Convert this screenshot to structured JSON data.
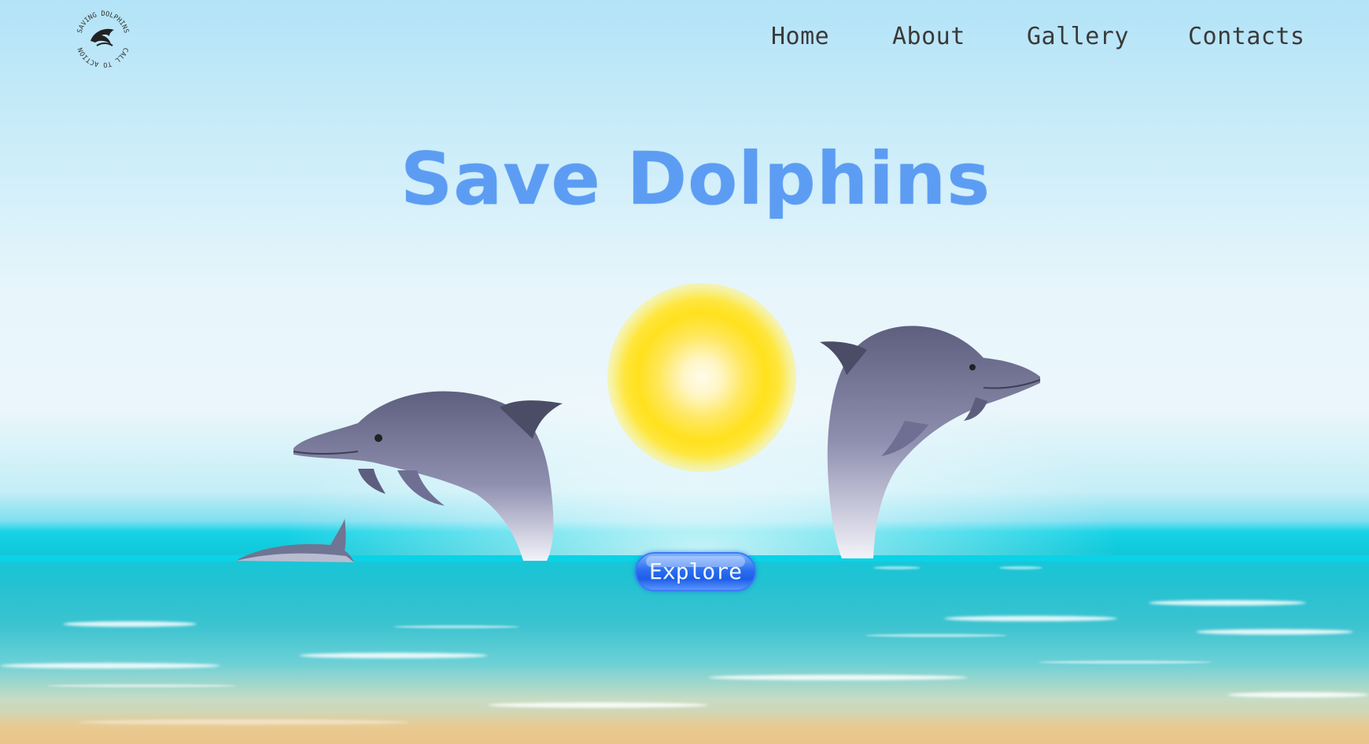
{
  "header": {
    "logo": {
      "text_top": "SAVING DOLPHINS",
      "text_bottom": "CALL TO ACTION",
      "icon": "dolphin-icon"
    },
    "nav": [
      {
        "label": "Home"
      },
      {
        "label": "About"
      },
      {
        "label": "Gallery"
      },
      {
        "label": "Contacts"
      }
    ]
  },
  "hero": {
    "title": "Save Dolphins",
    "cta_label": "Explore"
  },
  "colors": {
    "title": "#5c9df3",
    "button": "#2b6ff0",
    "sea": "#10c9da",
    "sun": "#ffe11d"
  }
}
